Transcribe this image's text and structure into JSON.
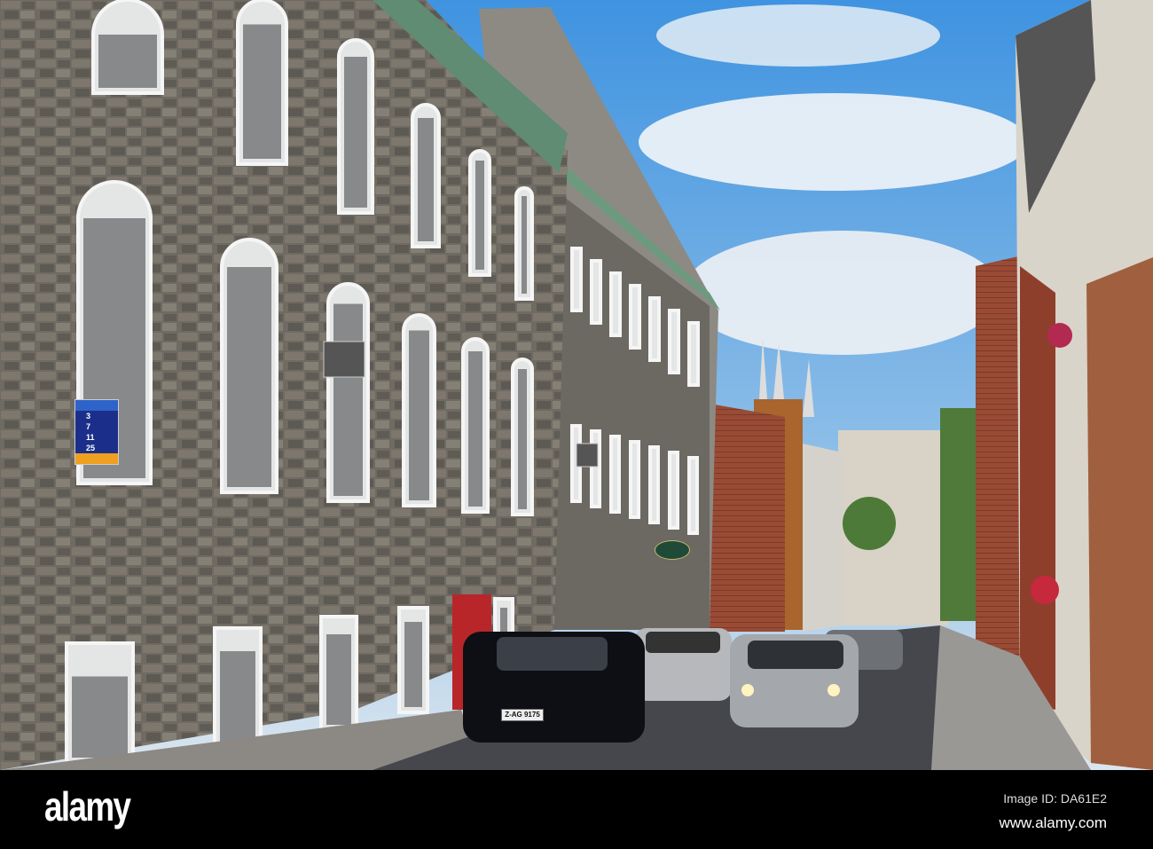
{
  "photo": {
    "bus_sign": {
      "numbers": [
        "3",
        "7",
        "11",
        "25"
      ]
    },
    "license_plate": "Z-AG 9175"
  },
  "footer": {
    "logo": "alamy",
    "image_id": "Image ID: DA61E2",
    "url": "www.alamy.com"
  },
  "colors": {
    "sky": "#4a9be0",
    "stone": "#6e6a62",
    "brick": "#9a4b35",
    "footer": "#000000"
  }
}
